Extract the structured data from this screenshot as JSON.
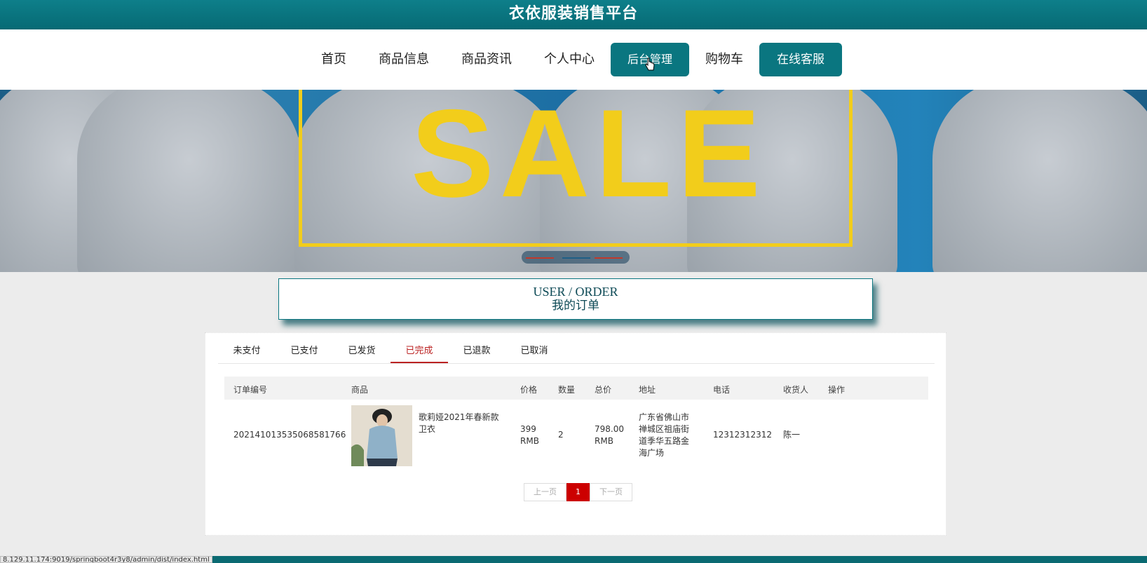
{
  "site": {
    "title": "衣依服装销售平台"
  },
  "nav": {
    "items": [
      {
        "label": "首页",
        "style": "text"
      },
      {
        "label": "商品信息",
        "style": "text"
      },
      {
        "label": "商品资讯",
        "style": "text"
      },
      {
        "label": "个人中心",
        "style": "text"
      },
      {
        "label": "后台管理",
        "style": "button"
      },
      {
        "label": "购物车",
        "style": "text"
      },
      {
        "label": "在线客服",
        "style": "button"
      }
    ]
  },
  "banner": {
    "text": "SALE",
    "accent_color": "#f2cd1b"
  },
  "heading": {
    "en": "USER / ORDER",
    "zh": "我的订单"
  },
  "tabs": {
    "items": [
      "未支付",
      "已支付",
      "已发货",
      "已完成",
      "已退款",
      "已取消"
    ],
    "active": "已完成"
  },
  "table": {
    "headers": [
      "订单编号",
      "商品",
      "价格",
      "数量",
      "总价",
      "地址",
      "电话",
      "收货人",
      "操作"
    ],
    "rows": [
      {
        "order_no": "20214101353506858176​6",
        "product_name": "歌莉娅2021年春新款卫衣",
        "price": "399 RMB",
        "quantity": "2",
        "total": "798.00 RMB",
        "address": "广东省佛山市禅城区祖庙街道季华五路金海广场",
        "phone": "12312312312",
        "receiver": "陈一"
      }
    ]
  },
  "pager": {
    "prev": "上一页",
    "current": "1",
    "next": "下一页"
  },
  "statusbar": {
    "url": "8.129.11.174:9019/springboot4r3y8/admin/dist/index.html"
  },
  "colors": {
    "brand": "#0a7680",
    "active_tab": "#b22222",
    "pager_current": "#cc0000"
  }
}
